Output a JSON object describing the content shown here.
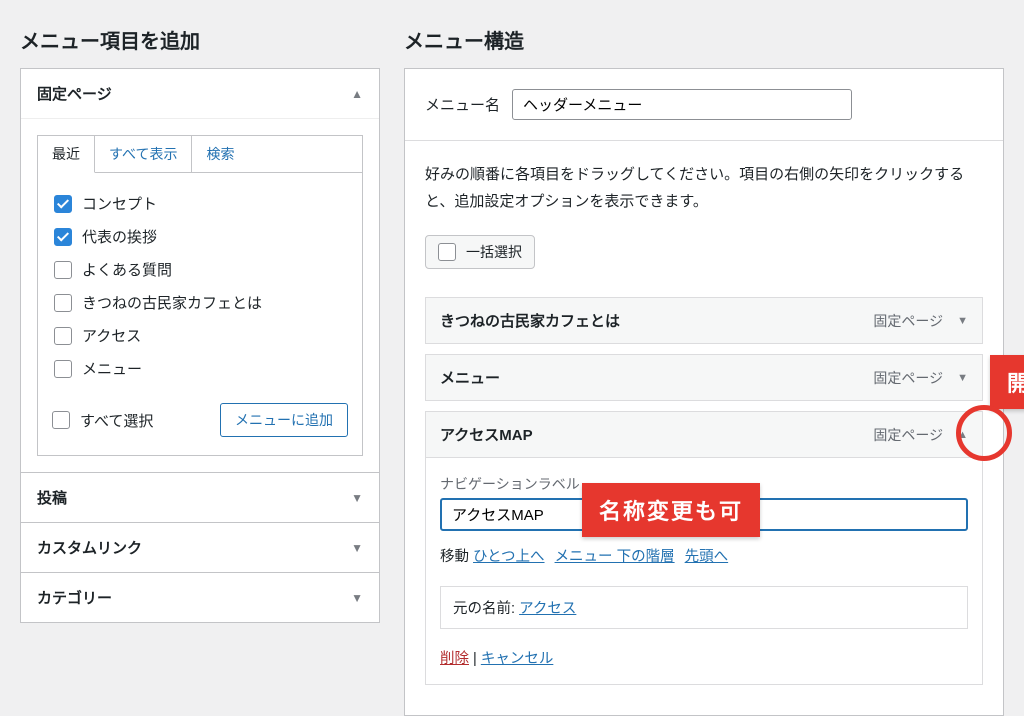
{
  "left": {
    "heading": "メニュー項目を追加",
    "accordion": {
      "pages": {
        "title": "固定ページ",
        "tabs": {
          "recent": "最近",
          "all": "すべて表示",
          "search": "検索"
        },
        "items": [
          {
            "label": "コンセプト",
            "checked": true
          },
          {
            "label": "代表の挨拶",
            "checked": true
          },
          {
            "label": "よくある質問",
            "checked": false
          },
          {
            "label": "きつねの古民家カフェとは",
            "checked": false
          },
          {
            "label": "アクセス",
            "checked": false
          },
          {
            "label": "メニュー",
            "checked": false
          }
        ],
        "select_all": "すべて選択",
        "add_button": "メニューに追加"
      },
      "posts": "投稿",
      "custom_links": "カスタムリンク",
      "categories": "カテゴリー"
    }
  },
  "right": {
    "heading": "メニュー構造",
    "menu_name_label": "メニュー名",
    "menu_name_value": "ヘッダーメニュー",
    "help": "好みの順番に各項目をドラッグしてください。項目の右側の矢印をクリックすると、追加設定オプションを表示できます。",
    "bulk_select": "一括選択",
    "items": [
      {
        "title": "きつねの古民家カフェとは",
        "type": "固定ページ"
      },
      {
        "title": "メニュー",
        "type": "固定ページ"
      },
      {
        "title": "アクセスMAP",
        "type": "固定ページ"
      }
    ],
    "expanded": {
      "nav_label_caption": "ナビゲーションラベル",
      "nav_label_value": "アクセスMAP",
      "move_label": "移動",
      "move_up": "ひとつ上へ",
      "move_under": "メニュー 下の階層",
      "move_top": "先頭へ",
      "original_label": "元の名前:",
      "original_link": "アクセス",
      "delete": "削除",
      "sep": " | ",
      "cancel": "キャンセル"
    }
  },
  "annotations": {
    "open": "開く",
    "rename": "名称変更も可"
  }
}
